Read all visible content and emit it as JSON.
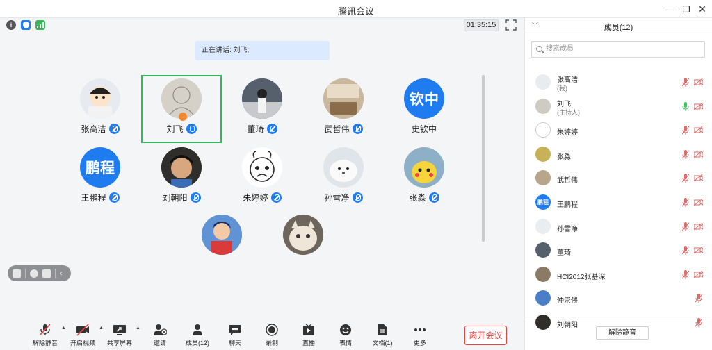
{
  "window": {
    "title": "腾讯会议"
  },
  "topbar": {
    "timer": "01:35:15"
  },
  "speaking": {
    "text": "正在讲话: 刘飞;"
  },
  "participants": [
    {
      "name": "张高洁",
      "mic": "muted",
      "avatar": "cartoon-boy"
    },
    {
      "name": "刘飞",
      "mic": "on",
      "avatar": "sketch-photo",
      "active": true
    },
    {
      "name": "董琦",
      "mic": "muted",
      "avatar": "girl-stairs"
    },
    {
      "name": "武哲伟",
      "mic": "muted",
      "avatar": "room-photo"
    },
    {
      "name": "史钦中",
      "mic": "none",
      "avatar_text": "钦中"
    },
    {
      "name": "王鹏程",
      "mic": "muted",
      "avatar_text": "鹏程"
    },
    {
      "name": "刘朝阳",
      "mic": "muted",
      "avatar": "boy-selfie"
    },
    {
      "name": "朱婷婷",
      "mic": "muted",
      "avatar": "doodle-face"
    },
    {
      "name": "孙雪净",
      "mic": "muted",
      "avatar": "seal"
    },
    {
      "name": "张淼",
      "mic": "muted",
      "avatar": "pikachu"
    },
    {
      "name": "",
      "mic": "none",
      "avatar": "anime-boy"
    },
    {
      "name": "",
      "mic": "none",
      "avatar": "cat"
    }
  ],
  "toolbar": {
    "unmute": "解除静音",
    "video": "开启视频",
    "share": "共享屏幕",
    "invite": "邀请",
    "members": "成员(12)",
    "chat": "聊天",
    "record": "录制",
    "live": "直播",
    "emoji": "表情",
    "docs": "文档(1)",
    "more": "更多",
    "leave": "离开会议"
  },
  "panel": {
    "title": "成员(12)",
    "search_placeholder": "搜索成员",
    "members": [
      {
        "name": "张高洁",
        "role": "(我)",
        "mic": "muted",
        "cam": "off"
      },
      {
        "name": "刘飞",
        "role": "(主持人)",
        "mic": "on",
        "cam": "off"
      },
      {
        "name": "朱婷婷",
        "role": "",
        "mic": "muted",
        "cam": "off"
      },
      {
        "name": "张淼",
        "role": "",
        "mic": "muted",
        "cam": "off"
      },
      {
        "name": "武哲伟",
        "role": "",
        "mic": "muted",
        "cam": "off"
      },
      {
        "name": "王鹏程",
        "role": "",
        "mic": "muted",
        "cam": "off",
        "avatar_text": "鹏程"
      },
      {
        "name": "孙雪净",
        "role": "",
        "mic": "muted",
        "cam": "off"
      },
      {
        "name": "董琦",
        "role": "",
        "mic": "muted",
        "cam": "off"
      },
      {
        "name": "HCI2012张基深",
        "role": "",
        "mic": "muted",
        "cam": "off"
      },
      {
        "name": "仲崇偎",
        "role": "",
        "mic": "muted",
        "cam": "none"
      },
      {
        "name": "刘朝阳",
        "role": "",
        "mic": "muted",
        "cam": "none"
      }
    ],
    "unmute_all": "解除静音"
  },
  "colors": {
    "accent": "#1f7cf5",
    "active_border": "#38b55b",
    "leave": "#e54545",
    "mic_on": "#3cc35c",
    "muted": "#e06a6a"
  }
}
